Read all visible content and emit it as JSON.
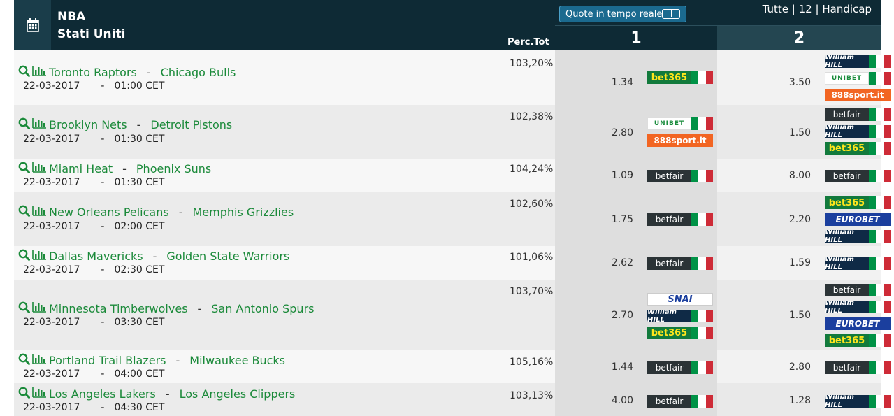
{
  "header": {
    "league": "NBA",
    "country": "Stati Uniti",
    "perc_label": "Perc.Tot",
    "live_button": "Quote in tempo reale",
    "filters": [
      "Tutte",
      "12",
      "Handicap"
    ],
    "filter_sep": "|",
    "col1": "1",
    "col2": "2"
  },
  "match_sep": "-",
  "date_sep": "-",
  "matches": [
    {
      "home": "Toronto Raptors",
      "away": "Chicago Bulls",
      "date": "22-03-2017",
      "time": "01:00 CET",
      "perc": "103,20%",
      "odd1": "1.34",
      "odd2": "3.50",
      "bk1": [
        {
          "logo": "bet365",
          "text": "bet365",
          "flag": true
        }
      ],
      "bk2": [
        {
          "logo": "williamhill",
          "text": "William HILL",
          "flag": true
        },
        {
          "logo": "unibet",
          "text": "UNIBET",
          "flag": true
        },
        {
          "logo": "sport888",
          "text": "888sport.it",
          "flag": false
        }
      ]
    },
    {
      "home": "Brooklyn Nets",
      "away": "Detroit Pistons",
      "date": "22-03-2017",
      "time": "01:30 CET",
      "perc": "102,38%",
      "odd1": "2.80",
      "odd2": "1.50",
      "bk1": [
        {
          "logo": "unibet",
          "text": "UNIBET",
          "flag": true
        },
        {
          "logo": "sport888",
          "text": "888sport.it",
          "flag": false
        }
      ],
      "bk2": [
        {
          "logo": "betfair",
          "text": "betfair",
          "flag": true
        },
        {
          "logo": "williamhill",
          "text": "William HILL",
          "flag": true
        },
        {
          "logo": "bet365",
          "text": "bet365",
          "flag": true
        }
      ]
    },
    {
      "home": "Miami Heat",
      "away": "Phoenix Suns",
      "date": "22-03-2017",
      "time": "01:30 CET",
      "perc": "104,24%",
      "odd1": "1.09",
      "odd2": "8.00",
      "bk1": [
        {
          "logo": "betfair",
          "text": "betfair",
          "flag": true
        }
      ],
      "bk2": [
        {
          "logo": "betfair",
          "text": "betfair",
          "flag": true
        }
      ]
    },
    {
      "home": "New Orleans Pelicans",
      "away": "Memphis Grizzlies",
      "date": "22-03-2017",
      "time": "02:00 CET",
      "perc": "102,60%",
      "odd1": "1.75",
      "odd2": "2.20",
      "bk1": [
        {
          "logo": "betfair",
          "text": "betfair",
          "flag": true
        }
      ],
      "bk2": [
        {
          "logo": "bet365",
          "text": "bet365",
          "flag": true
        },
        {
          "logo": "eurobet",
          "text": "EUROBET",
          "flag": false
        },
        {
          "logo": "williamhill",
          "text": "William HILL",
          "flag": true
        }
      ]
    },
    {
      "home": "Dallas Mavericks",
      "away": "Golden State Warriors",
      "date": "22-03-2017",
      "time": "02:30 CET",
      "perc": "101,06%",
      "odd1": "2.62",
      "odd2": "1.59",
      "bk1": [
        {
          "logo": "betfair",
          "text": "betfair",
          "flag": true
        }
      ],
      "bk2": [
        {
          "logo": "williamhill",
          "text": "William HILL",
          "flag": true
        }
      ]
    },
    {
      "home": "Minnesota Timberwolves",
      "away": "San Antonio Spurs",
      "date": "22-03-2017",
      "time": "03:30 CET",
      "perc": "103,70%",
      "odd1": "2.70",
      "odd2": "1.50",
      "bk1": [
        {
          "logo": "snai",
          "text": "SNAI",
          "flag": false
        },
        {
          "logo": "williamhill",
          "text": "William HILL",
          "flag": true
        },
        {
          "logo": "bet365",
          "text": "bet365",
          "flag": true
        }
      ],
      "bk2": [
        {
          "logo": "betfair",
          "text": "betfair",
          "flag": true
        },
        {
          "logo": "williamhill",
          "text": "William HILL",
          "flag": true
        },
        {
          "logo": "eurobet",
          "text": "EUROBET",
          "flag": false
        },
        {
          "logo": "bet365",
          "text": "bet365",
          "flag": true
        }
      ]
    },
    {
      "home": "Portland Trail Blazers",
      "away": "Milwaukee Bucks",
      "date": "22-03-2017",
      "time": "04:00 CET",
      "perc": "105,16%",
      "odd1": "1.44",
      "odd2": "2.80",
      "bk1": [
        {
          "logo": "betfair",
          "text": "betfair",
          "flag": true
        }
      ],
      "bk2": [
        {
          "logo": "betfair",
          "text": "betfair",
          "flag": true
        }
      ]
    },
    {
      "home": "Los Angeles Lakers",
      "away": "Los Angeles Clippers",
      "date": "22-03-2017",
      "time": "04:30 CET",
      "perc": "103,13%",
      "odd1": "4.00",
      "odd2": "1.28",
      "bk1": [
        {
          "logo": "betfair",
          "text": "betfair",
          "flag": true
        }
      ],
      "bk2": [
        {
          "logo": "williamhill",
          "text": "William HILL",
          "flag": true
        }
      ]
    }
  ]
}
